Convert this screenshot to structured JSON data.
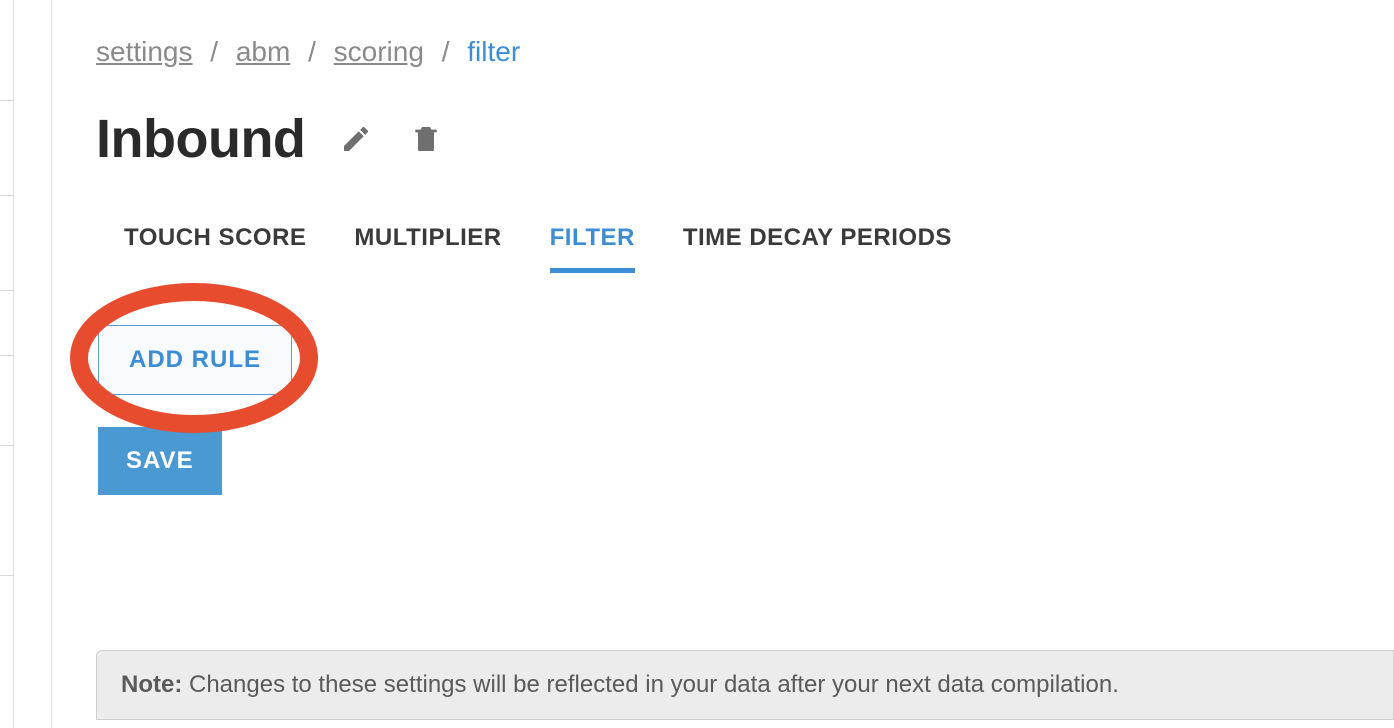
{
  "breadcrumb": {
    "items": [
      {
        "label": "settings"
      },
      {
        "label": "abm"
      },
      {
        "label": "scoring"
      }
    ],
    "current": "filter",
    "separator": "/"
  },
  "page": {
    "title": "Inbound"
  },
  "tabs": {
    "items": [
      {
        "label": "TOUCH SCORE",
        "active": false
      },
      {
        "label": "MULTIPLIER",
        "active": false
      },
      {
        "label": "FILTER",
        "active": true
      },
      {
        "label": "TIME DECAY PERIODS",
        "active": false
      }
    ]
  },
  "buttons": {
    "add_rule": "ADD RULE",
    "save": "SAVE"
  },
  "note": {
    "label": "Note:",
    "text": " Changes to these settings will be reflected in your data after your next data compilation."
  }
}
